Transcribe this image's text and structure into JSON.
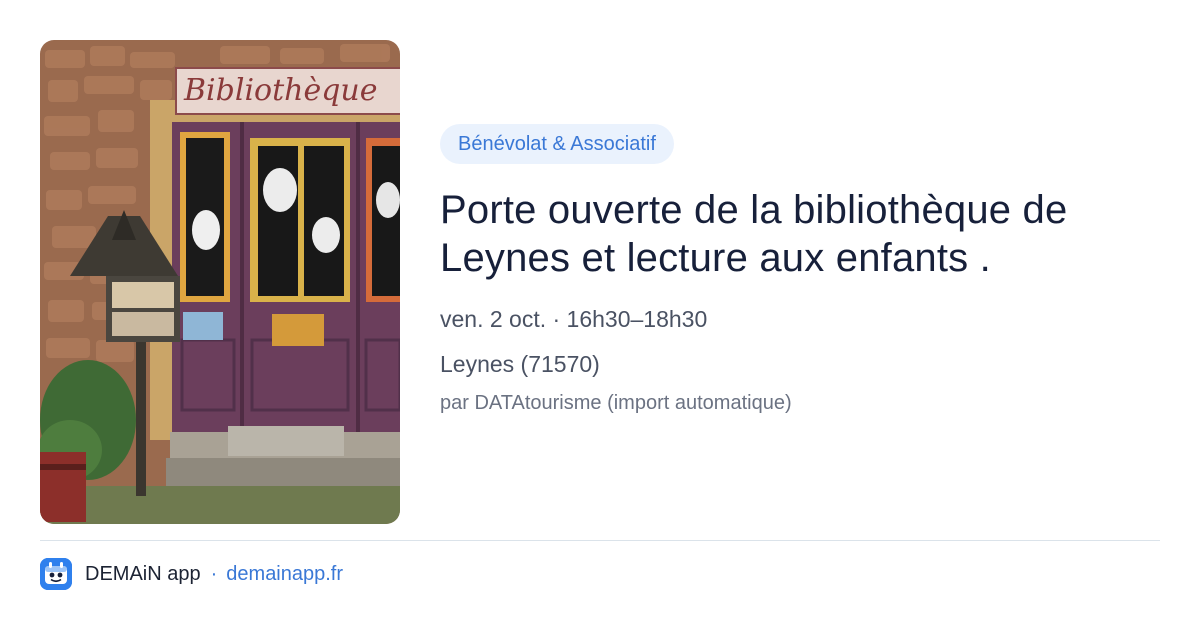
{
  "event": {
    "category": "Bénévolat & Associatif",
    "title": "Porte ouverte de la bibliothèque de Leynes et lecture aux enfants .",
    "datetime": "ven. 2 oct. · 16h30–18h30",
    "location": "Leynes (71570)",
    "organizer": "par DATAtourisme (import automatique)"
  },
  "photo": {
    "sign_text": "Bibliothèque"
  },
  "footer": {
    "app_name": "DEMAiN app",
    "separator": "·",
    "domain": "demainapp.fr"
  },
  "colors": {
    "accent": "#3a78d6",
    "tag_background": "#eaf2fd",
    "title": "#17203a",
    "door": "#6b3e5c"
  }
}
